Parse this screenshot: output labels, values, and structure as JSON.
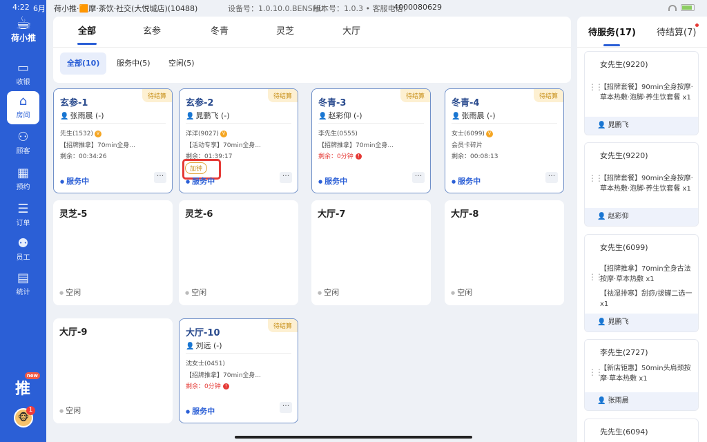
{
  "status_bar": {
    "time": "4:22",
    "date": "6月",
    "store": "荷小推·🟧摩·茶饮·社交(大悦城店)(10488)",
    "device": "设备号：1.0.10.0.BENSHU",
    "version": "版本号：1.0.3 • 客服电话：",
    "phone": "4000080629"
  },
  "sidebar": {
    "logo_text": "荷小推",
    "items": [
      {
        "label": "收银",
        "icon": "cash-register-icon"
      },
      {
        "label": "房间",
        "icon": "home-icon"
      },
      {
        "label": "顾客",
        "icon": "customer-icon"
      },
      {
        "label": "预约",
        "icon": "calendar-icon"
      },
      {
        "label": "订单",
        "icon": "order-icon"
      },
      {
        "label": "员工",
        "icon": "staff-icon"
      },
      {
        "label": "统计",
        "icon": "chart-icon"
      }
    ],
    "active_index": 1,
    "shop_badge": "new",
    "avatar_badge": "1"
  },
  "main": {
    "tabs": [
      "全部",
      "玄参",
      "冬青",
      "灵芝",
      "大厅"
    ],
    "filters": [
      "全部(10)",
      "服务中(5)",
      "空闲(5)"
    ],
    "rooms": [
      {
        "name": "玄参-1",
        "tag": "待结算",
        "tech": "张雨晨 (-)",
        "guest": "先生(1532)",
        "item": "【招牌推拿】70min全身...",
        "remain": "剩余：00:34:26",
        "status": "服务中"
      },
      {
        "name": "玄参-2",
        "tag": "待结算",
        "tech": "晁鹏飞 (-)",
        "guest": "洋洋(9027)",
        "item": "【活动专享】70min全身...",
        "remain": "剩余：01:39:17",
        "status": "服务中",
        "add_clock": "加钟"
      },
      {
        "name": "冬青-3",
        "tag": "待结算",
        "tech": "赵彩仰 (-)",
        "guest": "李先生(0555)",
        "item": "【招牌推拿】70min全身...",
        "remain": "剩余：0分钟",
        "status": "服务中"
      },
      {
        "name": "冬青-4",
        "tag": "待结算",
        "tech": "张雨晨 (-)",
        "guest": "女士(6099)",
        "item": "会员卡碎片",
        "remain": "剩余：00:08:13",
        "status": "服务中"
      },
      {
        "name": "灵芝-5",
        "status": "空闲"
      },
      {
        "name": "灵芝-6",
        "status": "空闲"
      },
      {
        "name": "大厅-7",
        "status": "空闲"
      },
      {
        "name": "大厅-8",
        "status": "空闲"
      },
      {
        "name": "大厅-9",
        "status": "空闲"
      },
      {
        "name": "大厅-10",
        "tag": "待结算",
        "tech": "刘远 (-)",
        "guest": "沈女士(0451)",
        "item": "【招牌推拿】70min全身...",
        "remain": "剩余：0分钟",
        "status": "服务中"
      }
    ]
  },
  "right_panel": {
    "tabs": [
      "待服务(17)",
      "待结算(7)"
    ],
    "orders": [
      {
        "name": "女先生(9220)",
        "services": [
          "【招牌套餐】90min全身按摩·草本热敷·泡脚·养生饮套餐 x1"
        ],
        "tech": "晁鹏飞"
      },
      {
        "name": "女先生(9220)",
        "services": [
          "【招牌套餐】90min全身按摩·草本热敷·泡脚·养生饮套餐 x1"
        ],
        "tech": "赵彩仰"
      },
      {
        "name": "女先生(6099)",
        "services": [
          "【招牌推拿】70min全身古法按摩·草本热敷 x1",
          "【祛湿排寒】刮痧/拔罐二选一 x1"
        ],
        "tech": "晁鹏飞"
      },
      {
        "name": "李先生(2727)",
        "services": [
          "【新店钜惠】50min头肩颈按摩·草本热敷 x1"
        ],
        "tech": "张雨晨"
      },
      {
        "name": "先先生(6094)",
        "services": [],
        "tech": ""
      }
    ]
  }
}
